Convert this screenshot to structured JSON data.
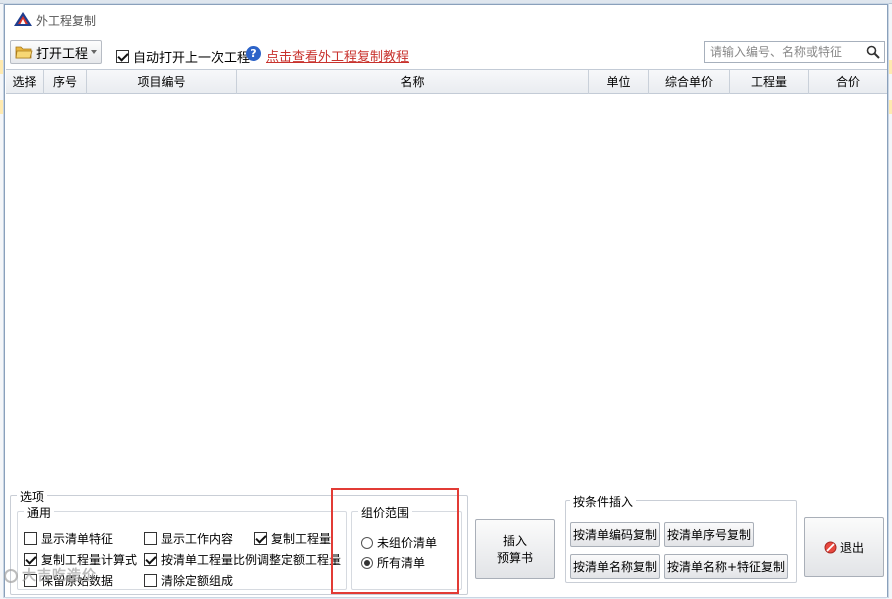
{
  "window": {
    "title": "外工程复制"
  },
  "toolbar": {
    "open_label": "打开工程",
    "auto_open_label": "自动打开上一次工程",
    "auto_open_checked": true,
    "help_link": "点击查看外工程复制教程",
    "search_placeholder": "请输入编号、名称或特征"
  },
  "grid": {
    "columns": [
      "选择",
      "序号",
      "项目编号",
      "名称",
      "单位",
      "综合单价",
      "工程量",
      "合价"
    ],
    "rows": []
  },
  "options": {
    "title": "选项",
    "general_title": "通用",
    "items": [
      {
        "label": "显示清单特征",
        "checked": false
      },
      {
        "label": "显示工作内容",
        "checked": false
      },
      {
        "label": "复制工程量",
        "checked": true
      },
      {
        "label": "复制工程量计算式",
        "checked": true
      },
      {
        "label": "按清单工程量比例调整定额工程量",
        "checked": true
      },
      {
        "label": "保留原始数据",
        "checked": false
      },
      {
        "label": "清除定额组成",
        "checked": false
      }
    ]
  },
  "pricing_scope": {
    "title": "组价范围",
    "options": [
      {
        "label": "未组价清单",
        "selected": false
      },
      {
        "label": "所有清单",
        "selected": true
      }
    ]
  },
  "insert_button": {
    "line1": "插入",
    "line2": "预算书"
  },
  "conditional_insert": {
    "title": "按条件插入",
    "buttons": [
      "按清单编码复制",
      "按清单序号复制",
      "按清单名称复制",
      "按清单名称+特征复制"
    ]
  },
  "exit_button": {
    "label": "退出"
  },
  "watermark": {
    "text": "大吉吃造价"
  },
  "colors": {
    "link": "#c8322d",
    "highlight_frame": "#e23b35",
    "help_icon": "#2d63c8"
  }
}
